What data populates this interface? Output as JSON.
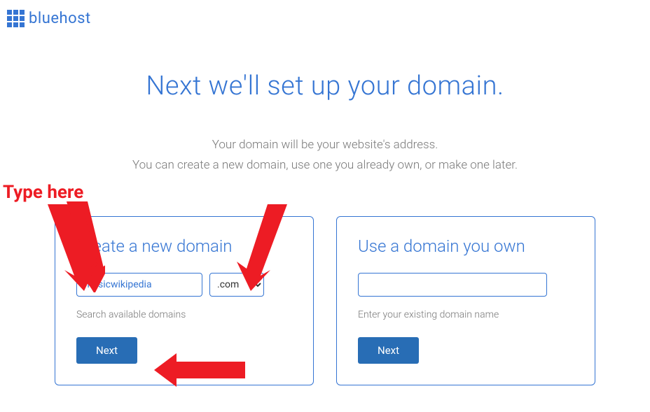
{
  "brand": "bluehost",
  "title": "Next we'll set up your domain.",
  "subtitle_line1": "Your domain will be your website's address.",
  "subtitle_line2": "You can create a new domain, use one you already own, or make one later.",
  "create_panel": {
    "title": "Create a new domain",
    "domain_value": "musicwikipedia",
    "tld_value": ".com",
    "helper": "Search available domains",
    "button": "Next"
  },
  "own_panel": {
    "title": "Use a domain you own",
    "domain_value": "",
    "helper": "Enter your existing domain name",
    "button": "Next"
  },
  "annotation": {
    "label": "Type here"
  }
}
